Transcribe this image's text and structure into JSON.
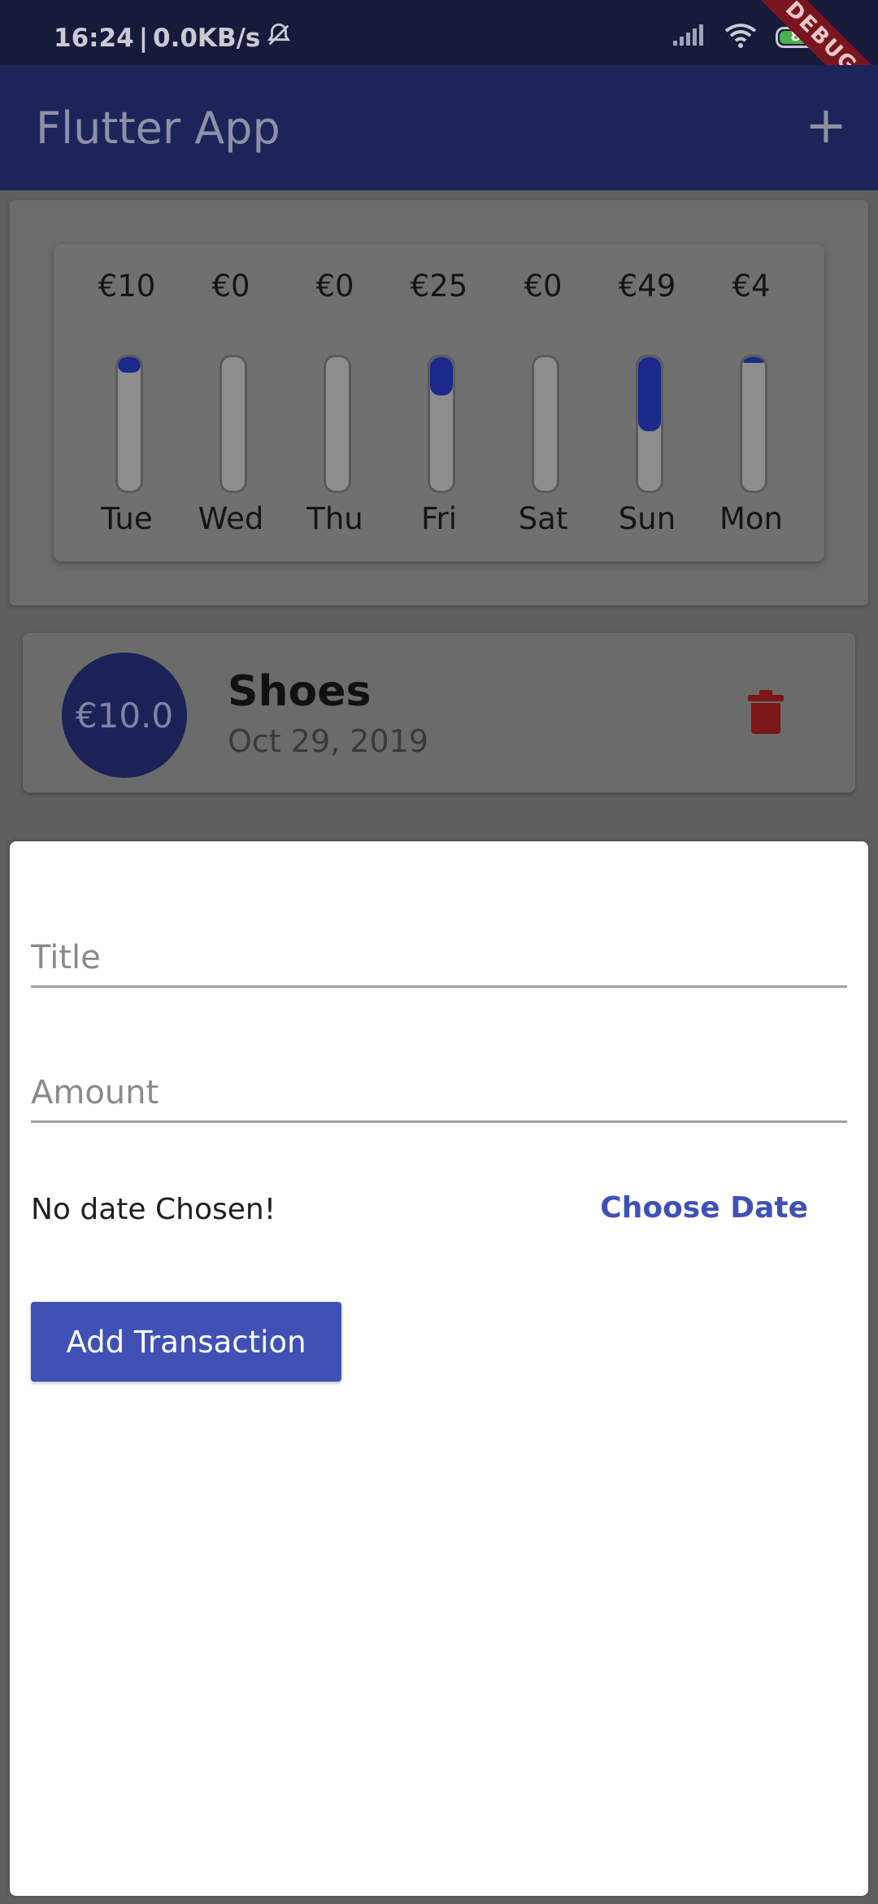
{
  "status_bar": {
    "time": "16:24",
    "network": "0.0KB/s",
    "battery": "80",
    "icons": [
      "muted-alarm-icon",
      "signal-icon",
      "wifi-icon",
      "battery-icon"
    ],
    "debug_badge": "DEBUG"
  },
  "app_bar": {
    "title": "Flutter App",
    "add_icon": "plus-icon",
    "color": "#1d2459"
  },
  "chart_data": {
    "type": "bar",
    "categories": [
      "Tue",
      "Wed",
      "Thu",
      "Fri",
      "Sat",
      "Sun",
      "Mon"
    ],
    "values": [
      10,
      0,
      0,
      25,
      0,
      49,
      4
    ],
    "value_labels": [
      "€10",
      "€0",
      "€0",
      "€25",
      "€0",
      "€49",
      "€4"
    ],
    "fill_fractions": [
      0.113,
      0.0,
      0.0,
      0.284,
      0.0,
      0.557,
      0.045
    ],
    "bar_color": "#1b2a8b"
  },
  "transactions": [
    {
      "amount": "€10.0",
      "title": "Shoes",
      "date": "Oct 29, 2019",
      "delete_icon": "trash-icon"
    }
  ],
  "form": {
    "title_label": "Title",
    "amount_label": "Amount",
    "date_status": "No date Chosen!",
    "choose_date": "Choose Date",
    "submit": "Add Transaction",
    "accent": "#3f51b5"
  }
}
